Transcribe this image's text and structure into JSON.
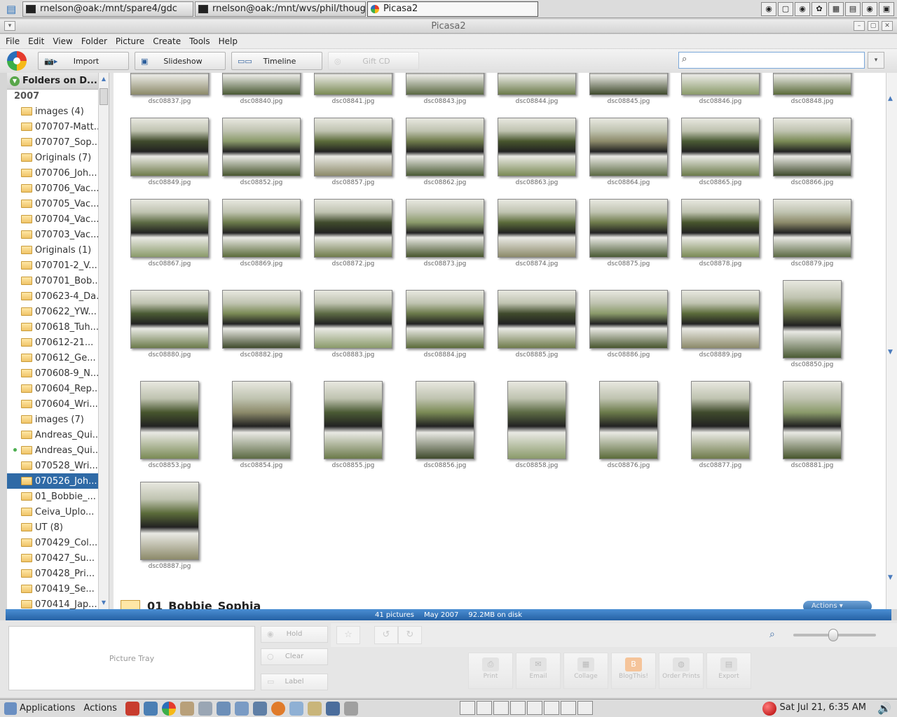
{
  "top_taskbar": {
    "windows": [
      {
        "label": "rnelson@oak:/mnt/spare4/gdc"
      },
      {
        "label": "rnelson@oak:/mnt/wvs/phil/thoughtlet"
      },
      {
        "label": "Picasa2"
      }
    ]
  },
  "window": {
    "title": "Picasa2"
  },
  "menu": [
    "File",
    "Edit",
    "View",
    "Folder",
    "Picture",
    "Create",
    "Tools",
    "Help"
  ],
  "toolbar": {
    "import_label": "Import",
    "slideshow_label": "Slideshow",
    "timeline_label": "Timeline",
    "giftcd_label": "Gift CD",
    "search_value": "",
    "search_placeholder": ""
  },
  "sidebar": {
    "header": "Folders on D...",
    "year": "2007",
    "folders": [
      {
        "label": "images (4)"
      },
      {
        "label": "070707-Matt..."
      },
      {
        "label": "070707_Sop..."
      },
      {
        "label": "Originals (7)"
      },
      {
        "label": "070706_Joh..."
      },
      {
        "label": "070706_Vac..."
      },
      {
        "label": "070705_Vac..."
      },
      {
        "label": "070704_Vac..."
      },
      {
        "label": "070703_Vac..."
      },
      {
        "label": "Originals (1)"
      },
      {
        "label": "070701-2_V..."
      },
      {
        "label": "070701_Bob..."
      },
      {
        "label": "070623-4_Da..."
      },
      {
        "label": "070622_YW..."
      },
      {
        "label": "070618_Tuh..."
      },
      {
        "label": "070612-21..."
      },
      {
        "label": "070612_Ge..."
      },
      {
        "label": "070608-9_N..."
      },
      {
        "label": "070604_Rep..."
      },
      {
        "label": "070604_Wri..."
      },
      {
        "label": "images (7)"
      },
      {
        "label": "Andreas_Qui..."
      },
      {
        "label": "Andreas_Qui..."
      },
      {
        "label": "070528_Wri..."
      },
      {
        "label": "070526_Joh..."
      },
      {
        "label": "01_Bobbie_..."
      },
      {
        "label": "Ceiva_Uplo..."
      },
      {
        "label": "UT (8)"
      },
      {
        "label": "070429_Col..."
      },
      {
        "label": "070427_Su..."
      },
      {
        "label": "070428_Pri..."
      },
      {
        "label": "070419_Se..."
      },
      {
        "label": "070414_Jap..."
      }
    ],
    "selected_index": 24,
    "marked_index": 22
  },
  "thumbnails": [
    {
      "file": "dsc08837.jpg"
    },
    {
      "file": "dsc08840.jpg"
    },
    {
      "file": "dsc08841.jpg"
    },
    {
      "file": "dsc08843.jpg"
    },
    {
      "file": "dsc08844.jpg"
    },
    {
      "file": "dsc08845.jpg"
    },
    {
      "file": "dsc08846.jpg"
    },
    {
      "file": "dsc08848.jpg"
    },
    {
      "file": "dsc08849.jpg"
    },
    {
      "file": "dsc08852.jpg"
    },
    {
      "file": "dsc08857.jpg"
    },
    {
      "file": "dsc08862.jpg"
    },
    {
      "file": "dsc08863.jpg"
    },
    {
      "file": "dsc08864.jpg"
    },
    {
      "file": "dsc08865.jpg"
    },
    {
      "file": "dsc08866.jpg"
    },
    {
      "file": "dsc08867.jpg"
    },
    {
      "file": "dsc08869.jpg"
    },
    {
      "file": "dsc08872.jpg"
    },
    {
      "file": "dsc08873.jpg"
    },
    {
      "file": "dsc08874.jpg"
    },
    {
      "file": "dsc08875.jpg"
    },
    {
      "file": "dsc08878.jpg"
    },
    {
      "file": "dsc08879.jpg"
    },
    {
      "file": "dsc08880.jpg"
    },
    {
      "file": "dsc08882.jpg"
    },
    {
      "file": "dsc08883.jpg"
    },
    {
      "file": "dsc08884.jpg"
    },
    {
      "file": "dsc08885.jpg"
    },
    {
      "file": "dsc08886.jpg"
    },
    {
      "file": "dsc08889.jpg"
    },
    {
      "file": "dsc08850.jpg"
    },
    {
      "file": "dsc08853.jpg"
    },
    {
      "file": "dsc08854.jpg"
    },
    {
      "file": "dsc08855.jpg"
    },
    {
      "file": "dsc08856.jpg"
    },
    {
      "file": "dsc08858.jpg"
    },
    {
      "file": "dsc08876.jpg"
    },
    {
      "file": "dsc08877.jpg"
    },
    {
      "file": "dsc08881.jpg"
    },
    {
      "file": "dsc08887.jpg"
    }
  ],
  "next_group": {
    "title": "01_Bobbie_Sophia",
    "actions_label": "Actions"
  },
  "status": {
    "pictures": "41 pictures",
    "date": "May 2007",
    "size": "92.2MB on disk"
  },
  "bottom": {
    "picture_tray": "Picture Tray",
    "hold": "Hold",
    "clear": "Clear",
    "label": "Label",
    "actions": [
      "Print",
      "Email",
      "Collage",
      "BlogThis!",
      "Order Prints",
      "Export"
    ],
    "zoom_level": 0.5
  },
  "bottom_taskbar": {
    "applications": "Applications",
    "actions": "Actions",
    "clock": "Sat Jul 21,  6:35 AM"
  },
  "colors": {
    "selection": "#2f6aa6",
    "statusbar": "#2f6aa6",
    "accent_green": "#58a64a"
  }
}
